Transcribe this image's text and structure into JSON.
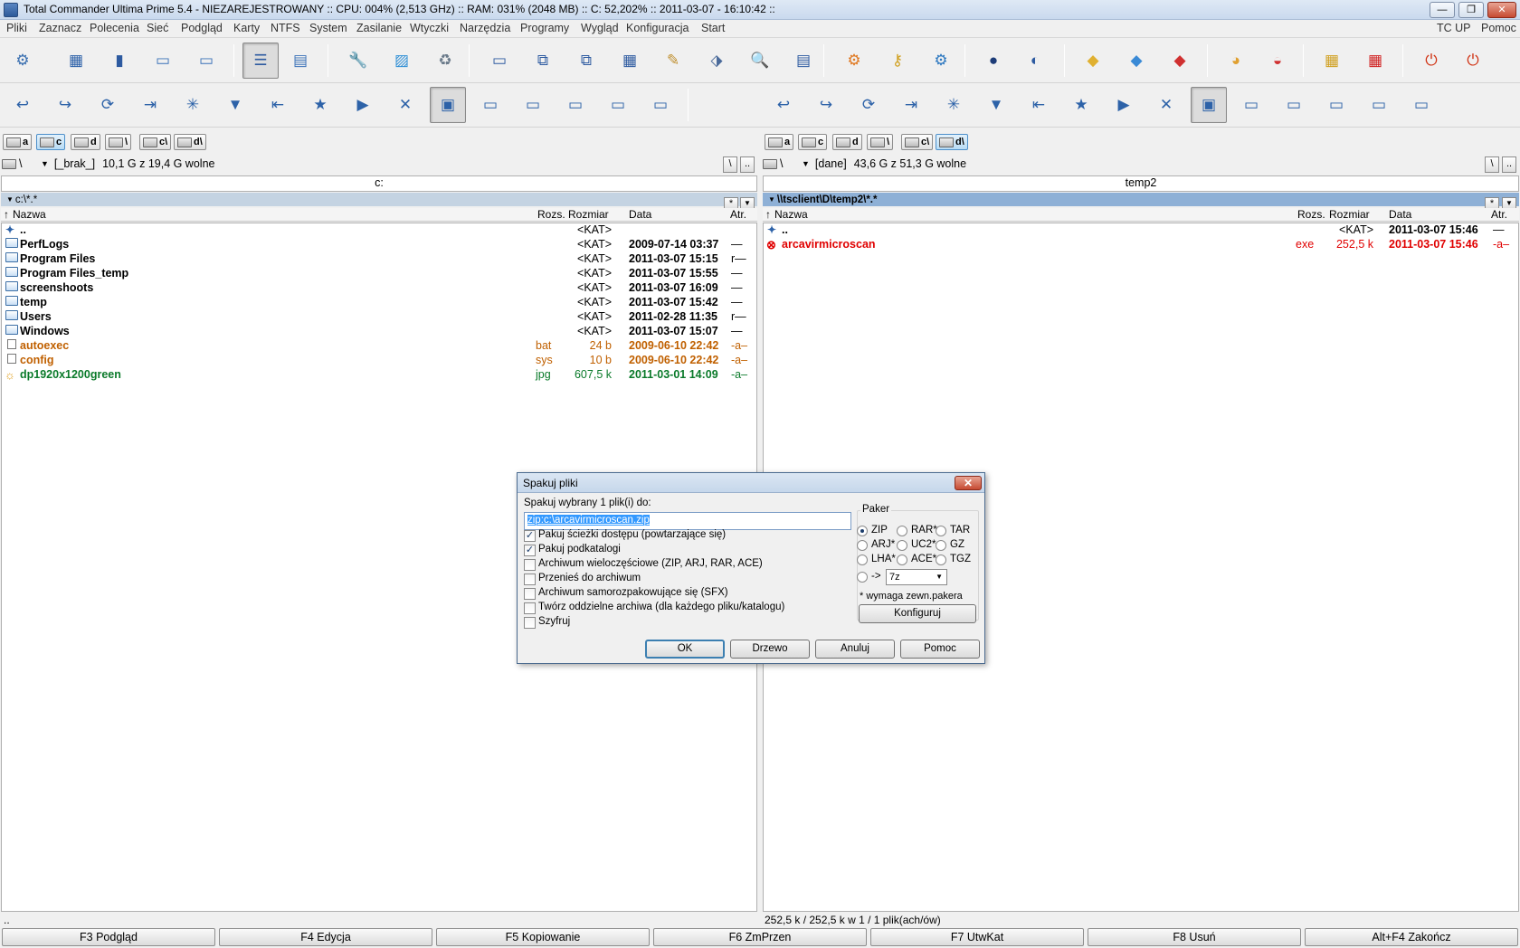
{
  "window": {
    "title": "Total Commander Ultima Prime 5.4 - NIEZAREJESTROWANY :: CPU: 004% (2,513 GHz) :: RAM: 031% (2048 MB) :: C: 52,202% :: 2011-03-07 - 16:10:42 ::",
    "min_label": "—",
    "max_label": "❐",
    "close_label": "✕"
  },
  "menu": {
    "items": [
      "Pliki",
      "Zaznacz",
      "Polecenia",
      "Sieć",
      "Podgląd",
      "Karty",
      "NTFS",
      "System",
      "Zasilanie",
      "Wtyczki",
      "Narzędzia",
      "Programy",
      "Wygląd",
      "Konfiguracja",
      "Start"
    ],
    "right": [
      "TC UP",
      "Pomoc"
    ]
  },
  "toolbar1_icons": [
    "gear-icon",
    "chip-icon",
    "book-icon",
    "window-icon",
    "window-star-icon",
    "list-view-icon",
    "brief-view-icon",
    "wrench-icon",
    "picture-icon",
    "trash-icon",
    "rect-icon",
    "copy-icon",
    "copy2-icon",
    "grid-icon",
    "edit-icon",
    "tag-icon",
    "search-icon",
    "folder-icon",
    "orange-gear-icon",
    "keys-icon",
    "blue-gear-icon",
    "globe-icon",
    "globe2-icon",
    "box-icon",
    "cube-icon",
    "red-box-icon",
    "pie-icon",
    "flag-icon",
    "tiles-icon",
    "red-tiles-icon",
    "power-icon",
    "shutdown-icon"
  ],
  "left": {
    "drives": [
      "a",
      "c",
      "d",
      "\\",
      "c\\",
      "d\\"
    ],
    "active_drive": 1,
    "path_drive": "\\",
    "label": "[_brak_]",
    "free": "10,1 G z 19,4 G wolne",
    "root_btn": "\\",
    "up_btn": "..",
    "header": "c:",
    "path": "c:\\*.*",
    "path_btn1": "*",
    "path_btn2": "▼",
    "columns": {
      "name": "Nazwa",
      "ext": "Rozs.",
      "size": "Rozmiar",
      "date": "Data",
      "attr": "Atr."
    },
    "files": [
      {
        "icon": "up",
        "name": "..",
        "ext": "",
        "size": "<KAT>",
        "date": "",
        "attr": "",
        "color": "#000000"
      },
      {
        "icon": "folder",
        "name": "PerfLogs",
        "ext": "",
        "size": "<KAT>",
        "date": "2009-07-14 03:37",
        "attr": "—",
        "color": "#000000"
      },
      {
        "icon": "folder",
        "name": "Program Files",
        "ext": "",
        "size": "<KAT>",
        "date": "2011-03-07 15:15",
        "attr": "r—",
        "color": "#000000"
      },
      {
        "icon": "folder",
        "name": "Program Files_temp",
        "ext": "",
        "size": "<KAT>",
        "date": "2011-03-07 15:55",
        "attr": "—",
        "color": "#000000"
      },
      {
        "icon": "folder",
        "name": "screenshoots",
        "ext": "",
        "size": "<KAT>",
        "date": "2011-03-07 16:09",
        "attr": "—",
        "color": "#000000"
      },
      {
        "icon": "folder",
        "name": "temp",
        "ext": "",
        "size": "<KAT>",
        "date": "2011-03-07 15:42",
        "attr": "—",
        "color": "#000000"
      },
      {
        "icon": "folder",
        "name": "Users",
        "ext": "",
        "size": "<KAT>",
        "date": "2011-02-28 11:35",
        "attr": "r—",
        "color": "#000000"
      },
      {
        "icon": "folder",
        "name": "Windows",
        "ext": "",
        "size": "<KAT>",
        "date": "2011-03-07 15:07",
        "attr": "—",
        "color": "#000000"
      },
      {
        "icon": "doc",
        "name": "autoexec",
        "ext": "bat",
        "size": "24 b",
        "date": "2009-06-10 22:42",
        "attr": "-a–",
        "color": "#c06000"
      },
      {
        "icon": "doc",
        "name": "config",
        "ext": "sys",
        "size": "10 b",
        "date": "2009-06-10 22:42",
        "attr": "-a–",
        "color": "#c06000"
      },
      {
        "icon": "img",
        "name": "dp1920x1200green",
        "ext": "jpg",
        "size": "607,5 k",
        "date": "2011-03-01 14:09",
        "attr": "-a–",
        "color": "#0a7a2a"
      }
    ],
    "status": ".."
  },
  "right": {
    "drives": [
      "a",
      "c",
      "d",
      "\\",
      "c\\",
      "d\\"
    ],
    "active_drive": 5,
    "path_drive": "\\",
    "label": "[dane]",
    "free": "43,6 G z 51,3 G wolne",
    "root_btn": "\\",
    "up_btn": "..",
    "header": "temp2",
    "path": "\\\\tsclient\\D\\temp2\\*.*",
    "path_btn1": "*",
    "path_btn2": "▼",
    "columns": {
      "name": "Nazwa",
      "ext": "Rozs.",
      "size": "Rozmiar",
      "date": "Data",
      "attr": "Atr."
    },
    "files": [
      {
        "icon": "up",
        "name": "..",
        "ext": "",
        "size": "<KAT>",
        "date": "2011-03-07 15:46",
        "attr": "—",
        "color": "#000000"
      },
      {
        "icon": "exe",
        "name": "arcavirmicroscan",
        "ext": "exe",
        "size": "252,5 k",
        "date": "2011-03-07 15:46",
        "attr": "-a–",
        "color": "#e00000"
      }
    ],
    "status": "252,5 k / 252,5 k w 1 / 1 plik(ach/ów)"
  },
  "fkeys": [
    "F3 Podgląd",
    "F4 Edycja",
    "F5 Kopiowanie",
    "F6 ZmPrzen",
    "F7 UtwKat",
    "F8 Usuń",
    "Alt+F4 Zakończ"
  ],
  "dialog": {
    "title": "Spakuj pliki",
    "close": "✕",
    "prompt": "Spakuj wybrany 1 plik(i) do:",
    "target": "zip:c:\\arcavirmicroscan.zip",
    "options": [
      {
        "label": "Pakuj ścieżki dostępu (powtarzające się)",
        "checked": true
      },
      {
        "label": "Pakuj podkatalogi",
        "checked": true
      },
      {
        "label": "Archiwum wieloczęściowe (ZIP, ARJ, RAR, ACE)",
        "checked": false
      },
      {
        "label": "Przenieś do archiwum",
        "checked": false
      },
      {
        "label": "Archiwum samorozpakowujące się (SFX)",
        "checked": false
      },
      {
        "label": "Twórz oddzielne archiwa (dla każdego pliku/katalogu)",
        "checked": false
      },
      {
        "label": "Szyfruj",
        "checked": false
      }
    ],
    "packer_label": "Paker",
    "packers": [
      {
        "label": "ZIP",
        "selected": true
      },
      {
        "label": "RAR*",
        "selected": false
      },
      {
        "label": "TAR",
        "selected": false
      },
      {
        "label": "ARJ*",
        "selected": false
      },
      {
        "label": "UC2*",
        "selected": false
      },
      {
        "label": "GZ",
        "selected": false
      },
      {
        "label": "LHA*",
        "selected": false
      },
      {
        "label": "ACE*",
        "selected": false
      },
      {
        "label": "TGZ",
        "selected": false
      }
    ],
    "other_packer_label": "->",
    "other_packer_value": "7z",
    "note": "* wymaga zewn.pakera",
    "configure": "Konfiguruj",
    "buttons": {
      "ok": "OK",
      "tree": "Drzewo",
      "cancel": "Anuluj",
      "help": "Pomoc"
    }
  }
}
